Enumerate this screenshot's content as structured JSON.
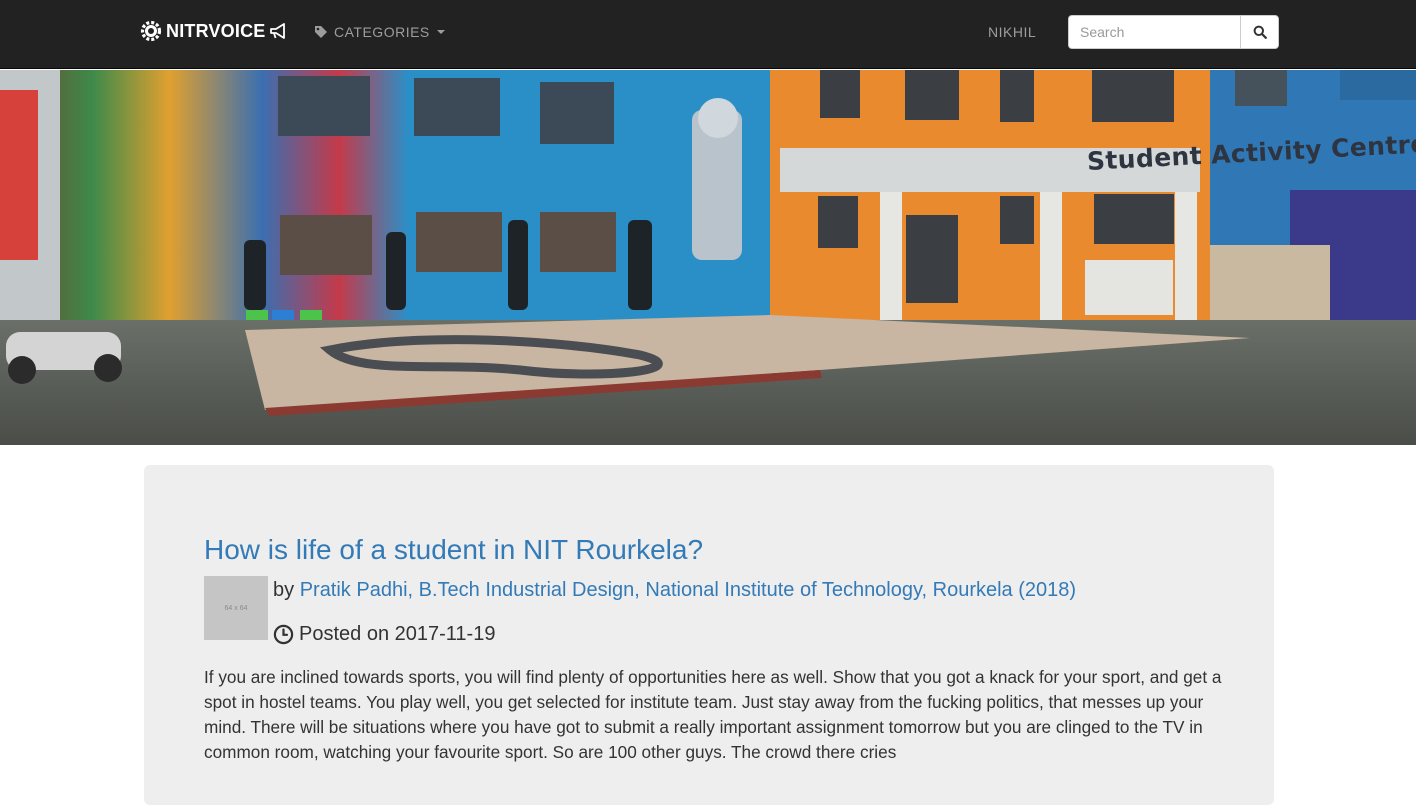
{
  "navbar": {
    "brand": "NITRVOICE",
    "categories_label": "CATEGORIES",
    "user_label": "NIKHIL",
    "search_placeholder": "Search",
    "icons": {
      "logo": "gear-icon",
      "brand_suffix": "megaphone-icon",
      "categories": "tags-icon",
      "caret": "chevron-down-icon",
      "search": "search-icon"
    }
  },
  "hero": {
    "sign_text": "Student Activity Centre"
  },
  "post": {
    "title": "How is life of a student in NIT Rourkela?",
    "thumbnail_text": "64 x 64",
    "by_prefix": "by",
    "author": "Pratik Padhi, B.Tech Industrial Design, National Institute of Technology, Rourkela (2018)",
    "posted_label": "Posted on 2017-11-19",
    "excerpt": "If you are inclined towards sports, you will find plenty of opportunities here as well. Show that you got a knack for your sport, and get a spot in hostel teams. You play well, you get selected for institute team. Just stay away from the fucking politics, that messes up your mind. There will be situations where you have got to submit a really important assignment tomorrow but you are clinged to the TV in common room, watching your favourite sport. So are 100 other guys. The crowd there cries"
  },
  "colors": {
    "navbar_bg": "#222222",
    "nav_text": "#9d9d9d",
    "link": "#337ab7",
    "card_bg": "#eeeeee",
    "text": "#333333"
  }
}
